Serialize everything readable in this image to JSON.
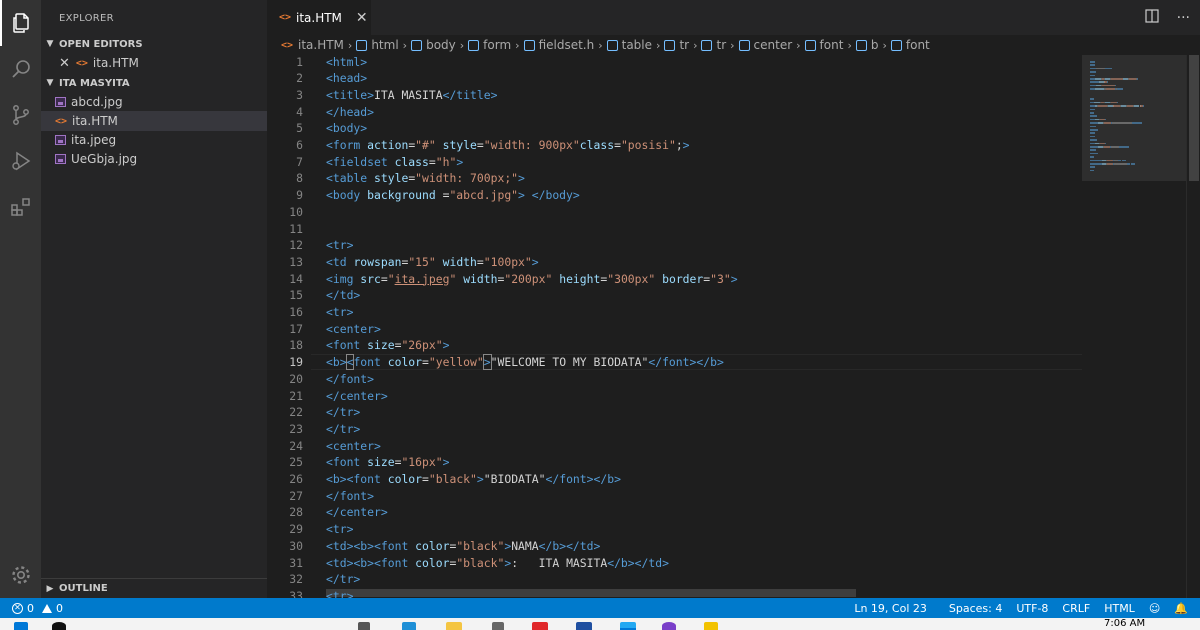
{
  "sidebar": {
    "title": "EXPLORER",
    "open_editors_label": "OPEN EDITORS",
    "open_editor_file": "ita.HTM",
    "folder_label": "ITA MASYITA",
    "files": [
      "abcd.jpg",
      "ita.HTM",
      "ita.jpeg",
      "UeGbja.jpg"
    ],
    "outline_label": "OUTLINE"
  },
  "tab": {
    "label": "ita.HTM"
  },
  "breadcrumb": [
    "ita.HTM",
    "html",
    "body",
    "form",
    "fieldset.h",
    "table",
    "tr",
    "tr",
    "center",
    "font",
    "b",
    "font"
  ],
  "editor": {
    "current_line": 19,
    "lines": [
      {
        "n": "1",
        "spans": [
          [
            "t",
            "<html>"
          ]
        ]
      },
      {
        "n": "2",
        "spans": [
          [
            "t",
            "<head>"
          ]
        ]
      },
      {
        "n": "3",
        "spans": [
          [
            "t",
            "<title>"
          ],
          [
            "txt",
            "ITA MASITA"
          ],
          [
            "t",
            "</title>"
          ]
        ]
      },
      {
        "n": "4",
        "spans": [
          [
            "t",
            "</head>"
          ]
        ]
      },
      {
        "n": "5",
        "spans": [
          [
            "t",
            "<body>"
          ]
        ]
      },
      {
        "n": "6",
        "spans": [
          [
            "t",
            "<form "
          ],
          [
            "a",
            "action"
          ],
          [
            "txt",
            "="
          ],
          [
            "s",
            "\"#\""
          ],
          [
            "txt",
            " "
          ],
          [
            "a",
            "style"
          ],
          [
            "txt",
            "="
          ],
          [
            "s",
            "\"width: 900px\""
          ],
          [
            "a",
            "class"
          ],
          [
            "txt",
            "="
          ],
          [
            "s",
            "\"posisi\""
          ],
          [
            "txt",
            ";"
          ],
          [
            "t",
            ">"
          ]
        ]
      },
      {
        "n": "7",
        "spans": [
          [
            "t",
            "<fieldset "
          ],
          [
            "a",
            "class"
          ],
          [
            "txt",
            "="
          ],
          [
            "s",
            "\"h\""
          ],
          [
            "t",
            ">"
          ]
        ]
      },
      {
        "n": "8",
        "spans": [
          [
            "t",
            "<table "
          ],
          [
            "a",
            "style"
          ],
          [
            "txt",
            "="
          ],
          [
            "s",
            "\"width: 700px;\""
          ],
          [
            "t",
            ">"
          ]
        ]
      },
      {
        "n": "9",
        "spans": [
          [
            "t",
            "<body "
          ],
          [
            "a",
            "background"
          ],
          [
            "txt",
            " ="
          ],
          [
            "s",
            "\"abcd.jpg\""
          ],
          [
            "t",
            ">"
          ],
          [
            "txt",
            " "
          ],
          [
            "t",
            "</body>"
          ]
        ]
      },
      {
        "n": "10",
        "spans": []
      },
      {
        "n": "11",
        "spans": []
      },
      {
        "n": "12",
        "spans": [
          [
            "t",
            "<tr>"
          ]
        ]
      },
      {
        "n": "13",
        "spans": [
          [
            "t",
            "<td "
          ],
          [
            "a",
            "rowspan"
          ],
          [
            "txt",
            "="
          ],
          [
            "s",
            "\"15\""
          ],
          [
            "txt",
            " "
          ],
          [
            "a",
            "width"
          ],
          [
            "txt",
            "="
          ],
          [
            "s",
            "\"100px\""
          ],
          [
            "t",
            ">"
          ]
        ]
      },
      {
        "n": "14",
        "spans": [
          [
            "t",
            "<img "
          ],
          [
            "a",
            "src"
          ],
          [
            "txt",
            "="
          ],
          [
            "s",
            "\""
          ],
          [
            "s link",
            "ita.jpeg"
          ],
          [
            "s",
            "\""
          ],
          [
            "txt",
            " "
          ],
          [
            "a",
            "width"
          ],
          [
            "txt",
            "="
          ],
          [
            "s",
            "\"200px\""
          ],
          [
            "txt",
            " "
          ],
          [
            "a",
            "height"
          ],
          [
            "txt",
            "="
          ],
          [
            "s",
            "\"300px\""
          ],
          [
            "txt",
            " "
          ],
          [
            "a",
            "border"
          ],
          [
            "txt",
            "="
          ],
          [
            "s",
            "\"3\""
          ],
          [
            "t",
            ">"
          ]
        ]
      },
      {
        "n": "15",
        "spans": [
          [
            "t",
            "</td>"
          ]
        ]
      },
      {
        "n": "16",
        "spans": [
          [
            "t",
            "<tr>"
          ]
        ]
      },
      {
        "n": "17",
        "spans": [
          [
            "t",
            "<center>"
          ]
        ]
      },
      {
        "n": "18",
        "spans": [
          [
            "t",
            "<font "
          ],
          [
            "a",
            "size"
          ],
          [
            "txt",
            "="
          ],
          [
            "s",
            "\"26px\""
          ],
          [
            "t",
            ">"
          ]
        ]
      },
      {
        "n": "19",
        "spans": [
          [
            "t",
            "<b>"
          ],
          [
            "t brk",
            "<"
          ],
          [
            "t",
            "font "
          ],
          [
            "a",
            "color"
          ],
          [
            "txt",
            "="
          ],
          [
            "s",
            "\"yellow\""
          ],
          [
            "t brk",
            ">"
          ],
          [
            "txt",
            "\"WELCOME TO MY BIODATA\""
          ],
          [
            "t",
            "</font>"
          ],
          [
            "t",
            "</b>"
          ]
        ]
      },
      {
        "n": "20",
        "spans": [
          [
            "t",
            "</font>"
          ]
        ]
      },
      {
        "n": "21",
        "spans": [
          [
            "t",
            "</center>"
          ]
        ]
      },
      {
        "n": "22",
        "spans": [
          [
            "t",
            "</tr>"
          ]
        ]
      },
      {
        "n": "23",
        "spans": [
          [
            "t",
            "</tr>"
          ]
        ]
      },
      {
        "n": "24",
        "spans": [
          [
            "t",
            "<center>"
          ]
        ]
      },
      {
        "n": "25",
        "spans": [
          [
            "t",
            "<font "
          ],
          [
            "a",
            "size"
          ],
          [
            "txt",
            "="
          ],
          [
            "s",
            "\"16px\""
          ],
          [
            "t",
            ">"
          ]
        ]
      },
      {
        "n": "26",
        "spans": [
          [
            "t",
            "<b>"
          ],
          [
            "t",
            "<font "
          ],
          [
            "a",
            "color"
          ],
          [
            "txt",
            "="
          ],
          [
            "s",
            "\"black\""
          ],
          [
            "t",
            ">"
          ],
          [
            "txt",
            "\"BIODATA\""
          ],
          [
            "t",
            "</font>"
          ],
          [
            "t",
            "</b>"
          ]
        ]
      },
      {
        "n": "27",
        "spans": [
          [
            "t",
            "</font>"
          ]
        ]
      },
      {
        "n": "28",
        "spans": [
          [
            "t",
            "</center>"
          ]
        ]
      },
      {
        "n": "29",
        "spans": [
          [
            "t",
            "<tr>"
          ]
        ]
      },
      {
        "n": "30",
        "spans": [
          [
            "t",
            "<td>"
          ],
          [
            "t",
            "<b>"
          ],
          [
            "t",
            "<font "
          ],
          [
            "a",
            "color"
          ],
          [
            "txt",
            "="
          ],
          [
            "s",
            "\"black\""
          ],
          [
            "t",
            ">"
          ],
          [
            "txt",
            "NAMA"
          ],
          [
            "t",
            "</b>"
          ],
          [
            "t",
            "</td>"
          ]
        ]
      },
      {
        "n": "31",
        "spans": [
          [
            "t",
            "<td>"
          ],
          [
            "t",
            "<b>"
          ],
          [
            "t",
            "<font "
          ],
          [
            "a",
            "color"
          ],
          [
            "txt",
            "="
          ],
          [
            "s",
            "\"black\""
          ],
          [
            "t",
            ">"
          ],
          [
            "txt",
            ":   ITA MASITA"
          ],
          [
            "t",
            "</b>"
          ],
          [
            "t",
            "</td>"
          ]
        ]
      },
      {
        "n": "32",
        "spans": [
          [
            "t",
            "</tr>"
          ]
        ]
      },
      {
        "n": "33",
        "spans": [
          [
            "t",
            "<tr>"
          ]
        ]
      }
    ]
  },
  "status": {
    "errors": "0",
    "warnings": "0",
    "position": "Ln 19, Col 23",
    "spaces": "Spaces: 4",
    "encoding": "UTF-8",
    "eol": "CRLF",
    "language": "HTML"
  },
  "taskbar": {
    "time": "7:06 AM"
  },
  "colors": {
    "accent": "#007acc",
    "tag": "#569cd6",
    "attribute": "#9cdcfe",
    "string": "#ce9178"
  }
}
